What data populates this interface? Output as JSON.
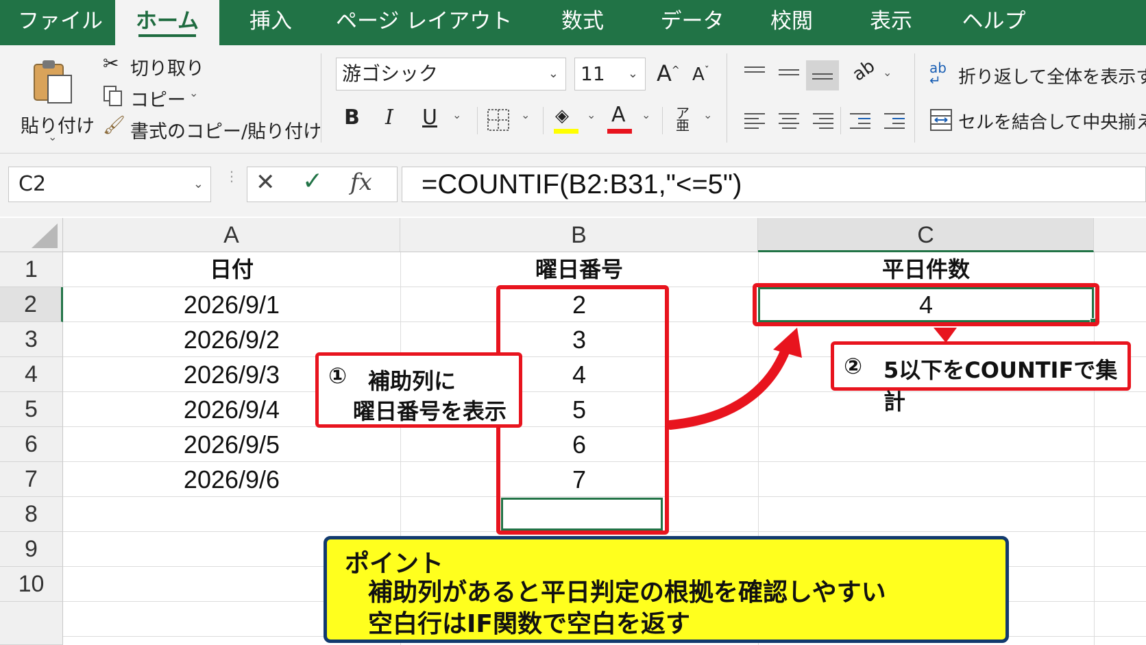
{
  "ribbon_tabs": [
    "ファイル",
    "ホーム",
    "挿入",
    "ページ レイアウト",
    "数式",
    "データ",
    "校閲",
    "表示",
    "ヘルプ"
  ],
  "clipboard": {
    "paste": "貼り付け",
    "cut": "切り取り",
    "copy": "コピー",
    "format_painter": "書式のコピー/貼り付け"
  },
  "font": {
    "name": "游ゴシック",
    "size": "11",
    "bold": "B",
    "italic": "I",
    "underline": "U",
    "grow": "A",
    "shrink": "A",
    "font_color": "A"
  },
  "alignment": {
    "wrap_text": "折り返して全体を表示する",
    "merge_center": "セルを結合して中央揃え"
  },
  "formula_bar": {
    "name_box": "C2",
    "cancel": "✕",
    "enter": "✓",
    "fx": "fx",
    "formula": "=COUNTIF(B2:B31,\"<=5\")"
  },
  "columns": [
    "A",
    "B",
    "C"
  ],
  "rows": [
    "1",
    "2",
    "3",
    "4",
    "5",
    "6",
    "7",
    "8",
    "9",
    "10"
  ],
  "sheet": {
    "headers": [
      "日付",
      "曜日番号",
      "平日件数"
    ],
    "dates": [
      "2026/9/1",
      "2026/9/2",
      "2026/9/3",
      "2026/9/4",
      "2026/9/5",
      "2026/9/6"
    ],
    "weekday_numbers": [
      "2",
      "3",
      "4",
      "5",
      "6",
      "7"
    ],
    "weekday_count": "4"
  },
  "annotations": {
    "callout1_num": "①",
    "callout1_line1": "補助列に",
    "callout1_line2": "曜日番号を表示",
    "callout2_num": "②",
    "callout2_text": "5以下をCOUNTIFで集計",
    "point_title": "ポイント",
    "point_line1": "補助列があると平日判定の根拠を確認しやすい",
    "point_line2": "空白行はIF関数で空白を返す"
  },
  "colors": {
    "excel_green": "#217346",
    "highlight_red": "#e8141e",
    "point_yellow": "#ffff1e",
    "point_border": "#123a6e"
  }
}
